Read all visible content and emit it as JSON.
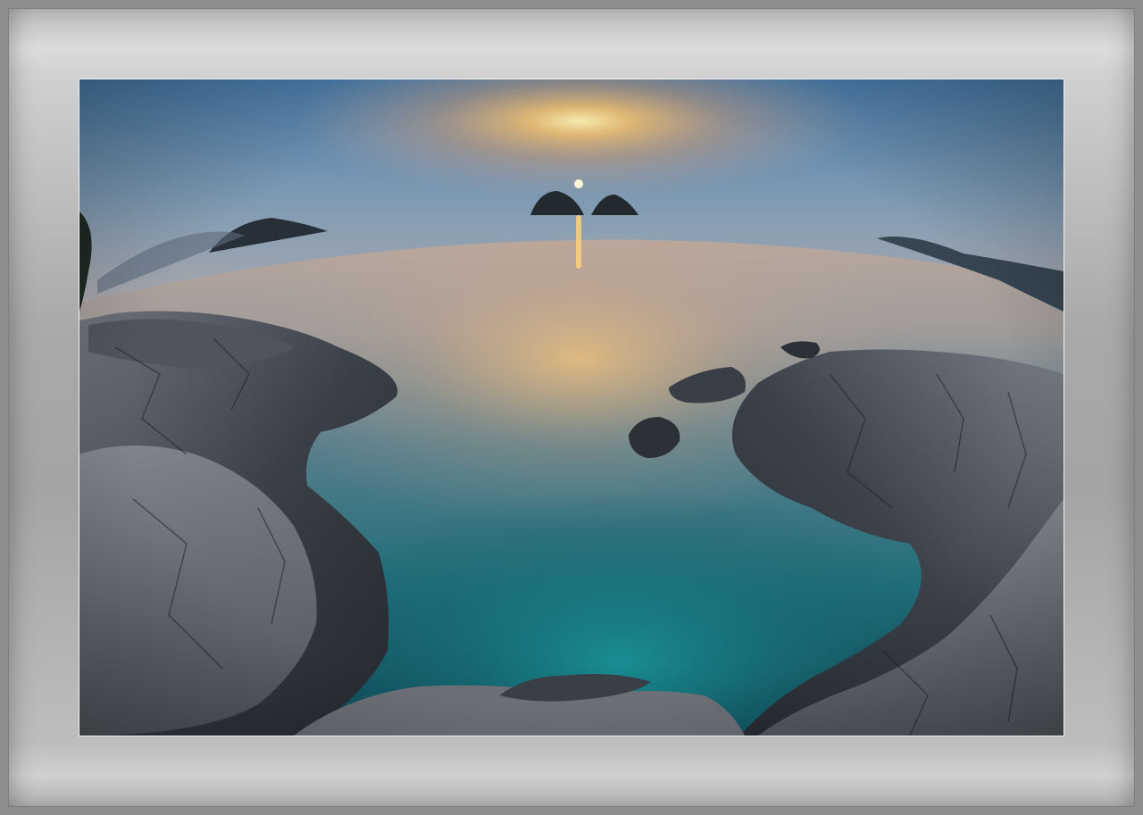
{
  "image": {
    "subject": "",
    "colors": {
      "frame": "#8e8e8e",
      "mat": "#bdbdbd",
      "sky_top": "#3c6f9a",
      "sky_glow": "#f2b25a",
      "sun": "#fff6c8",
      "water_far": "#b9a89a",
      "water_near": "#1b6f78",
      "rock_dark": "#2b3038",
      "rock_light": "#8d8f95"
    }
  }
}
